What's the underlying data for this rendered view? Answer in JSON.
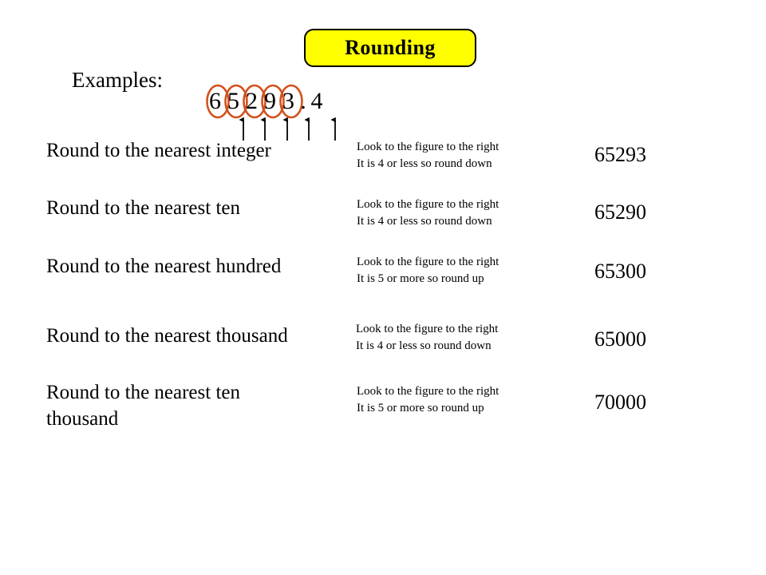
{
  "title": {
    "text": "Rounding",
    "badge_fill": "#FFFF00",
    "badge_border": "#000000"
  },
  "examples": {
    "label": "Examples:",
    "number_digits": [
      "6",
      "5",
      "2",
      "9",
      "3"
    ],
    "decimal_point": ".",
    "fraction_digit": "4",
    "full_number": "65293.4",
    "circle_color": "#D2521E",
    "arrow_color": "#000000",
    "arrow_count": 5
  },
  "rows": [
    {
      "label": "Round to the nearest integer",
      "note_line1": "Look to the figure to the right",
      "note_line2": "It is 4 or less so round down",
      "result": "65293"
    },
    {
      "label": "Round to the nearest ten",
      "note_line1": "Look to the figure to the right",
      "note_line2": "It is 4 or less so round down",
      "result": "65290"
    },
    {
      "label": "Round to the nearest hundred",
      "note_line1": "Look to the figure to the right",
      "note_line2": "It is 5 or more so round up",
      "result": "65300"
    },
    {
      "label": "Round to the nearest thousand",
      "note_line1": "Look to the figure to the right",
      "note_line2": "It is 4 or less so round down",
      "result": "65000"
    },
    {
      "label": "Round to the nearest ten thousand",
      "note_line1": "Look to the figure to the right",
      "note_line2": "It is 5 or more so round up",
      "result": "70000"
    }
  ]
}
